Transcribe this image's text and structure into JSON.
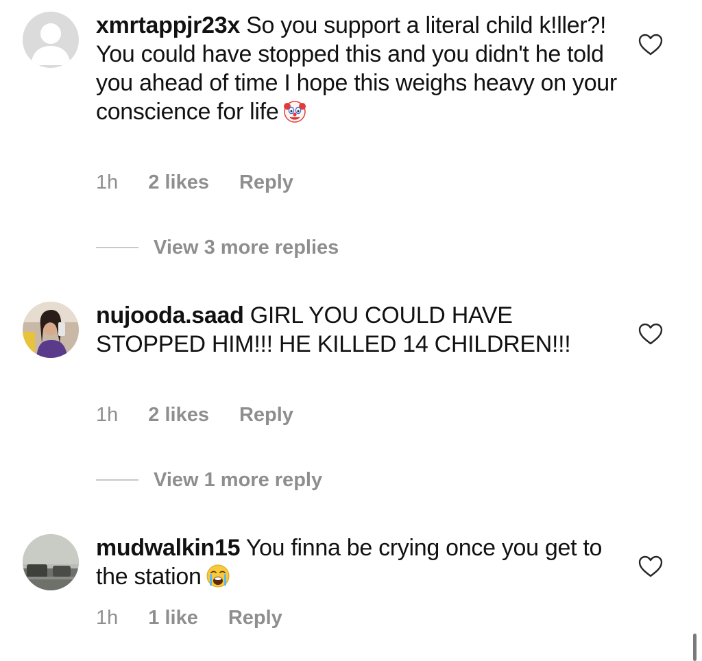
{
  "comments": [
    {
      "username": "xmrtappjr23x",
      "text": " So you support a literal child k!ller?! You could have stopped this and you didn't he told you ahead of time I hope this weighs heavy on your conscience for life",
      "emoji": "clown-face-icon",
      "time": "1h",
      "likes": "2 likes",
      "reply": "Reply",
      "view_more": "View 3 more replies"
    },
    {
      "username": "nujooda.saad",
      "text": " GIRL YOU COULD HAVE STOPPED HIM!!! HE KILLED 14 CHILDREN!!!",
      "time": "1h",
      "likes": "2 likes",
      "reply": "Reply",
      "view_more": "View 1 more reply"
    },
    {
      "username": "mudwalkin15",
      "text": " You finna be crying once you get to the station",
      "emoji": "loudly-crying-face-icon",
      "time": "1h",
      "likes": "1 like",
      "reply": "Reply"
    }
  ],
  "colors": {
    "text": "#111111",
    "secondary": "#8e8e8e",
    "divider": "#c7c7c7"
  }
}
